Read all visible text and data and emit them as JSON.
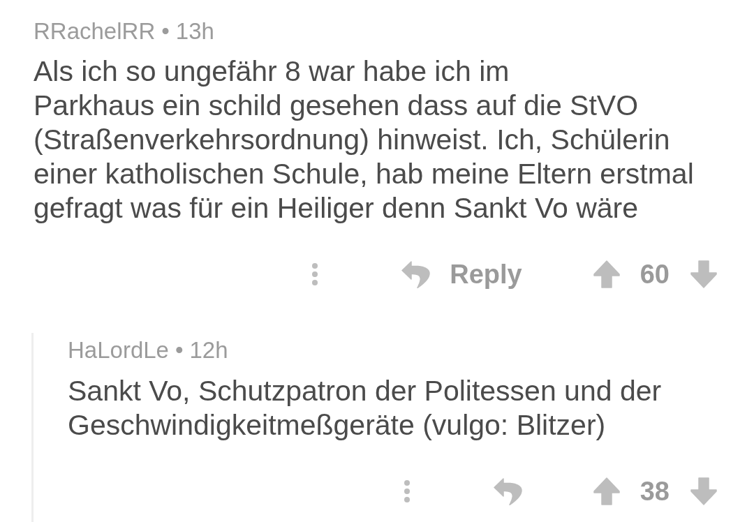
{
  "comments": [
    {
      "author": "RRachelRR",
      "separator": "•",
      "age": "13h",
      "body_lines": [
        "Als ich so ungefähr 8 war habe ich im",
        "Parkhaus ein schild gesehen dass auf die StVO",
        "(Straßenverkehrsordnung) hinweist. Ich, Schülerin",
        "einer katholischen Schule, hab meine Eltern erstmal",
        "gefragt was für ein Heiliger denn Sankt Vo wäre"
      ],
      "reply_label": "Reply",
      "score": "60",
      "replies": [
        {
          "author": "HaLordLe",
          "separator": "•",
          "age": "12h",
          "body_lines": [
            "Sankt Vo, Schutzpatron der Politessen und der",
            "Geschwindigkeitmeßgeräte (vulgo: Blitzer)"
          ],
          "score": "38"
        }
      ]
    }
  ]
}
